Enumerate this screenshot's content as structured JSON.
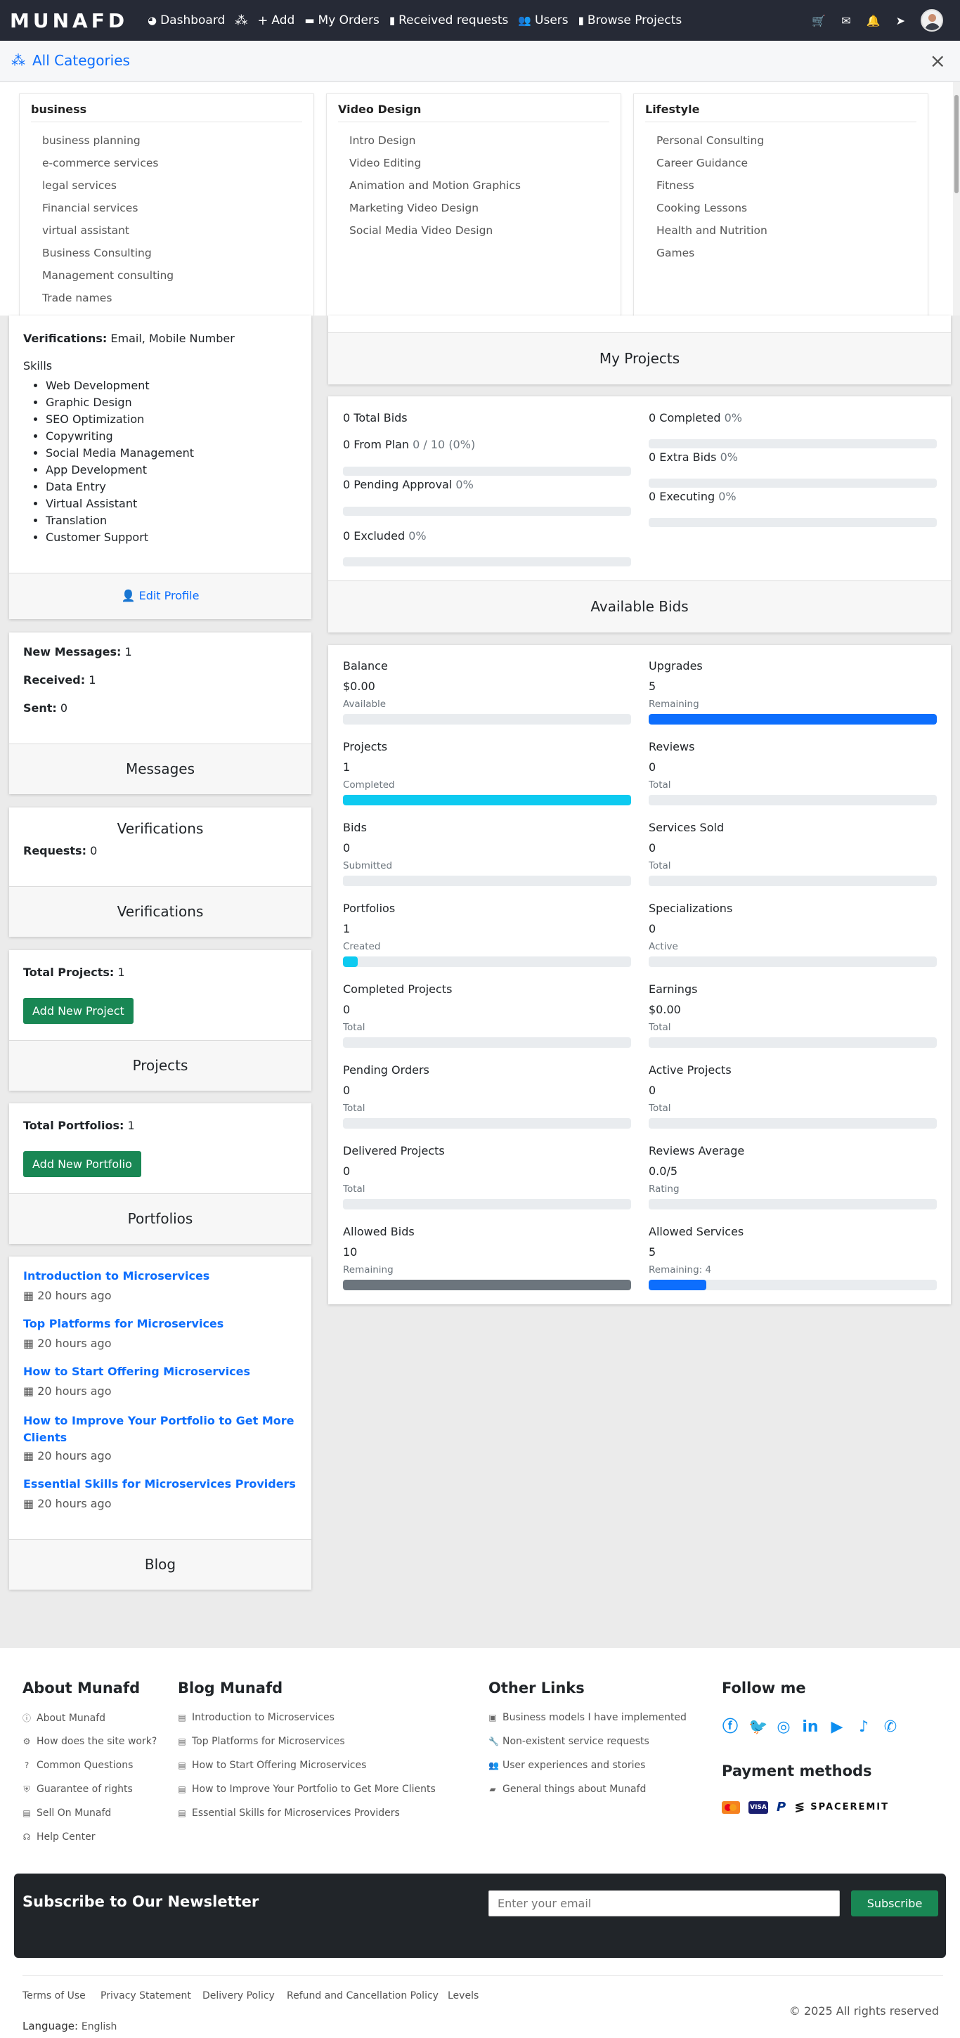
{
  "nav": {
    "logo": "MUNAFD",
    "items": [
      {
        "label": "Dashboard",
        "icon": "dashboard-icon"
      },
      {
        "label": "",
        "icon": "categories-icon"
      },
      {
        "label": "Add",
        "icon": "plus-icon"
      },
      {
        "label": "My Orders",
        "icon": "folder-icon"
      },
      {
        "label": "Received requests",
        "icon": "clipboard-icon"
      },
      {
        "label": "Users",
        "icon": "users-icon"
      },
      {
        "label": "Browse Projects",
        "icon": "clipboard-icon"
      }
    ],
    "right_icons": [
      "cart-icon",
      "envelope-icon",
      "bell-icon",
      "cursor-icon",
      "avatar"
    ]
  },
  "categories_bar": {
    "title": "All Categories"
  },
  "megamenu": [
    {
      "title": "business",
      "items": [
        "business planning",
        "e-commerce services",
        "legal services",
        "Financial services",
        "virtual assistant",
        "Business Consulting",
        "Management consulting",
        "Trade names"
      ]
    },
    {
      "title": "Video Design",
      "items": [
        "Intro Design",
        "Video Editing",
        "Animation and Motion Graphics",
        "Marketing Video Design",
        "Social Media Video Design"
      ]
    },
    {
      "title": "Lifestyle",
      "items": [
        "Personal Consulting",
        "Career Guidance",
        "Fitness",
        "Cooking Lessons",
        "Health and Nutrition",
        "Games"
      ]
    }
  ],
  "profile": {
    "verifications_label": "Verifications:",
    "verifications_value": "Email, Mobile Number",
    "skills_label": "Skills",
    "skills": [
      "Web Development",
      "Graphic Design",
      "SEO Optimization",
      "Copywriting",
      "Social Media Management",
      "App Development",
      "Data Entry",
      "Virtual Assistant",
      "Translation",
      "Customer Support"
    ],
    "edit_label": "Edit Profile"
  },
  "messages": {
    "new_label": "New Messages:",
    "new_value": "1",
    "received_label": "Received:",
    "received_value": "1",
    "sent_label": "Sent:",
    "sent_value": "0",
    "footer": "Messages"
  },
  "verifications": {
    "title": "Verifications",
    "requests_label": "Requests:",
    "requests_value": "0",
    "footer": "Verifications"
  },
  "projects": {
    "total_label": "Total Projects:",
    "total_value": "1",
    "button": "Add New Project",
    "footer": "Projects"
  },
  "portfolios": {
    "total_label": "Total Portfolios:",
    "total_value": "1",
    "button": "Add New Portfolio",
    "footer": "Portfolios"
  },
  "blog": {
    "posts": [
      {
        "title": "Introduction to Microservices",
        "time": "20 hours ago"
      },
      {
        "title": "Top Platforms for Microservices",
        "time": "20 hours ago"
      },
      {
        "title": "How to Start Offering Microservices",
        "time": "20 hours ago"
      },
      {
        "title": "How to Improve Your Portfolio to Get More Clients",
        "time": "20 hours ago"
      },
      {
        "title": "Essential Skills for Microservices Providers",
        "time": "20 hours ago"
      }
    ],
    "footer": "Blog"
  },
  "my_projects": {
    "footer": "My Projects"
  },
  "bids": {
    "total": "0 Total Bids",
    "from_plan": "0 From Plan",
    "from_plan_detail": "0 / 10 (0%)",
    "pending": "0 Pending Approval",
    "pending_pct": "0%",
    "excluded": "0 Excluded",
    "excluded_pct": "0%",
    "completed": "0 Completed",
    "completed_pct": "0%",
    "extra": "0 Extra Bids",
    "extra_pct": "0%",
    "executing": "0 Executing",
    "executing_pct": "0%",
    "levels": {
      "from_plan": 0,
      "pending": 0,
      "excluded": 0,
      "completed": 0,
      "extra": 0,
      "executing": 0
    },
    "footer": "Available Bids"
  },
  "stats": [
    {
      "title": "Balance",
      "value": "$0.00",
      "sub": "Available",
      "level": 0,
      "color": "#e9ecef"
    },
    {
      "title": "Upgrades",
      "value": "5",
      "sub": "Remaining",
      "level": 1,
      "color": "#0d6efd"
    },
    {
      "title": "Projects",
      "value": "1",
      "sub": "Completed",
      "level": 1,
      "color": "#0dcaf0"
    },
    {
      "title": "Reviews",
      "value": "0",
      "sub": "Total",
      "level": 0,
      "color": "#e9ecef"
    },
    {
      "title": "Bids",
      "value": "0",
      "sub": "Submitted",
      "level": 0,
      "color": "#e9ecef"
    },
    {
      "title": "Services Sold",
      "value": "0",
      "sub": "Total",
      "level": 0,
      "color": "#e9ecef"
    },
    {
      "title": "Portfolios",
      "value": "1",
      "sub": "Created",
      "level": 0.05,
      "color": "#0dcaf0"
    },
    {
      "title": "Specializations",
      "value": "0",
      "sub": "Active",
      "level": 0,
      "color": "#e9ecef"
    },
    {
      "title": "Completed Projects",
      "value": "0",
      "sub": "Total",
      "level": 0,
      "color": "#e9ecef"
    },
    {
      "title": "Earnings",
      "value": "$0.00",
      "sub": "Total",
      "level": 0,
      "color": "#e9ecef"
    },
    {
      "title": "Pending Orders",
      "value": "0",
      "sub": "Total",
      "level": 0,
      "color": "#e9ecef"
    },
    {
      "title": "Active Projects",
      "value": "0",
      "sub": "Total",
      "level": 0,
      "color": "#e9ecef"
    },
    {
      "title": "Delivered Projects",
      "value": "0",
      "sub": "Total",
      "level": 0,
      "color": "#e9ecef"
    },
    {
      "title": "Reviews Average",
      "value": "0.0/5",
      "sub": "Rating",
      "level": 0,
      "color": "#e9ecef"
    },
    {
      "title": "Allowed Bids",
      "value": "10",
      "sub": "Remaining",
      "level": 1,
      "color": "#6c757d"
    },
    {
      "title": "Allowed Services",
      "value": "5",
      "sub": "Remaining: 4",
      "level": 0.2,
      "color": "#0d6efd"
    }
  ],
  "footer": {
    "about_title": "About Munafd",
    "about_links": [
      "About Munafd",
      "How does the site work?",
      "Common Questions",
      "Guarantee of rights",
      "Sell On Munafd",
      "Help Center"
    ],
    "blog_title": "Blog Munafd",
    "blog_links": [
      "Introduction to Microservices",
      "Top Platforms for Microservices",
      "How to Start Offering Microservices",
      "How to Improve Your Portfolio to Get More Clients",
      "Essential Skills for Microservices Providers"
    ],
    "other_title": "Other Links",
    "other_links": [
      "Business models I have implemented",
      "Non-existent service requests",
      "User experiences and stories",
      "General things about Munafd"
    ],
    "follow_title": "Follow me",
    "social": [
      "facebook-icon",
      "twitter-icon",
      "instagram-icon",
      "linkedin-icon",
      "youtube-icon",
      "tiktok-icon",
      "whatsapp-icon"
    ],
    "payment_title": "Payment methods",
    "payment_brand": "SPACEREMIT",
    "newsletter_title": "Subscribe to Our Newsletter",
    "newsletter_placeholder": "Enter your email",
    "subscribe": "Subscribe",
    "legal_links": [
      "Terms of Use",
      "Privacy Statement",
      "Delivery Policy",
      "Refund and Cancellation Policy",
      "Levels"
    ],
    "copyright": "© 2025 All rights reserved",
    "language_label": "Language:",
    "language_value": "English"
  }
}
